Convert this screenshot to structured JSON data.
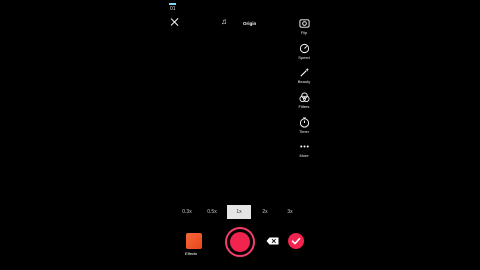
{
  "top": {
    "timer": "01",
    "sound_label": "Origin"
  },
  "side_menu": [
    {
      "label": "Flip",
      "icon": "flip-camera-icon"
    },
    {
      "label": "Speed",
      "icon": "speed-icon"
    },
    {
      "label": "Beauty",
      "icon": "beauty-wand-icon"
    },
    {
      "label": "Filters",
      "icon": "filters-icon"
    },
    {
      "label": "Timer",
      "icon": "timer-icon"
    },
    {
      "label": "More",
      "icon": "more-dots-icon"
    }
  ],
  "zoom": {
    "options": [
      "0.3x",
      "0.5x",
      "1x",
      "2x",
      "3x"
    ],
    "selected": "1x"
  },
  "bottom": {
    "effects_label": "Effects"
  },
  "colors": {
    "accent": "#f0244e",
    "selected_zoom_bg": "#e5e5e5",
    "progress": "#7fd6f2"
  }
}
